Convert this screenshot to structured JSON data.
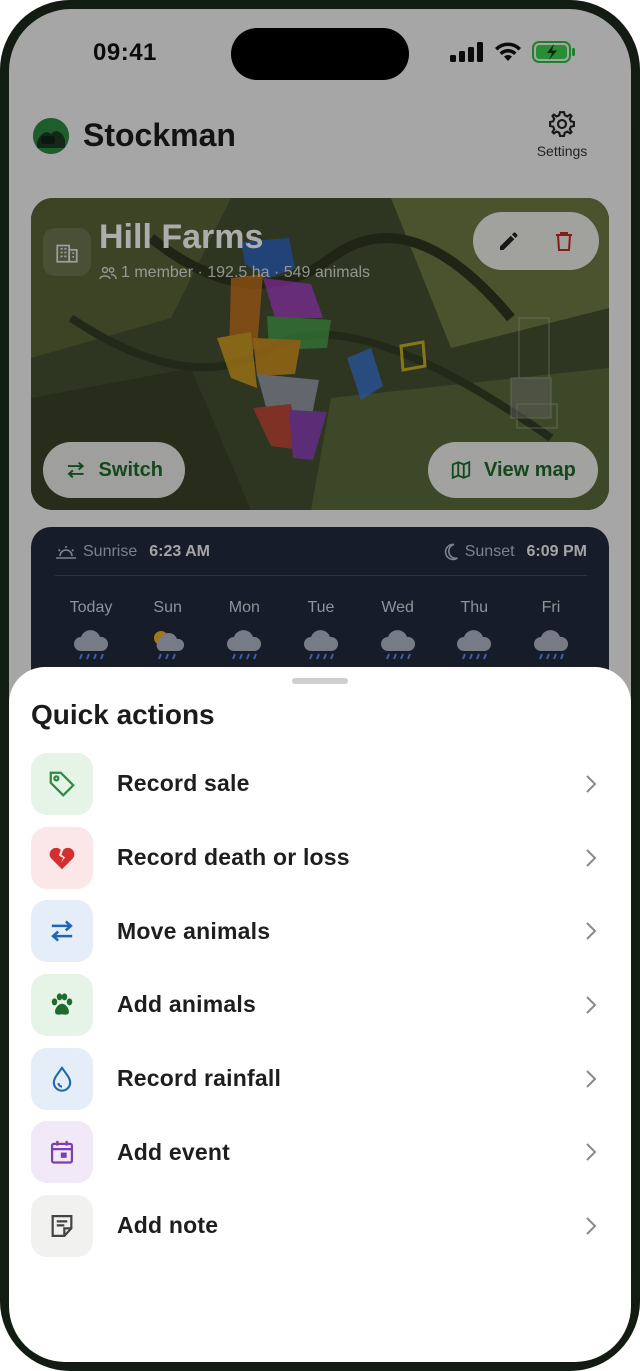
{
  "status_bar": {
    "time": "09:41"
  },
  "header": {
    "app_name": "Stockman",
    "settings_label": "Settings"
  },
  "farm": {
    "name": "Hill Farms",
    "meta": "1 member · 192.5 ha · 549 animals",
    "switch_label": "Switch",
    "view_map_label": "View map"
  },
  "weather": {
    "sunrise_label": "Sunrise",
    "sunrise_time": "6:23 AM",
    "sunset_label": "Sunset",
    "sunset_time": "6:09 PM",
    "days": [
      {
        "label": "Today",
        "icon": "rain-cloud-icon"
      },
      {
        "label": "Sun",
        "icon": "sun-rain-cloud-icon"
      },
      {
        "label": "Mon",
        "icon": "rain-cloud-icon"
      },
      {
        "label": "Tue",
        "icon": "rain-cloud-icon"
      },
      {
        "label": "Wed",
        "icon": "rain-cloud-icon"
      },
      {
        "label": "Thu",
        "icon": "rain-cloud-icon"
      },
      {
        "label": "Fri",
        "icon": "rain-cloud-icon"
      }
    ]
  },
  "quick_actions": {
    "title": "Quick actions",
    "items": [
      {
        "label": "Record sale",
        "icon": "tag-icon",
        "color": "#2e8b3e",
        "bg": "#e6f4e8"
      },
      {
        "label": "Record death or loss",
        "icon": "broken-heart-icon",
        "color": "#d32f2f",
        "bg": "#fbe7e7"
      },
      {
        "label": "Move animals",
        "icon": "swap-arrows-icon",
        "color": "#1f66b0",
        "bg": "#e5eef8"
      },
      {
        "label": "Add animals",
        "icon": "paw-icon",
        "color": "#1f6b2c",
        "bg": "#e6f4e8"
      },
      {
        "label": "Record rainfall",
        "icon": "water-drop-icon",
        "color": "#1f66b0",
        "bg": "#e5eef8"
      },
      {
        "label": "Add event",
        "icon": "calendar-icon",
        "color": "#7b3fb0",
        "bg": "#f1e8f8"
      },
      {
        "label": "Add note",
        "icon": "note-icon",
        "color": "#444444",
        "bg": "#f1f1ef"
      }
    ]
  },
  "colors": {
    "accent": "#1d6b2a",
    "danger": "#c62828",
    "frame": "#1d2a1c"
  }
}
